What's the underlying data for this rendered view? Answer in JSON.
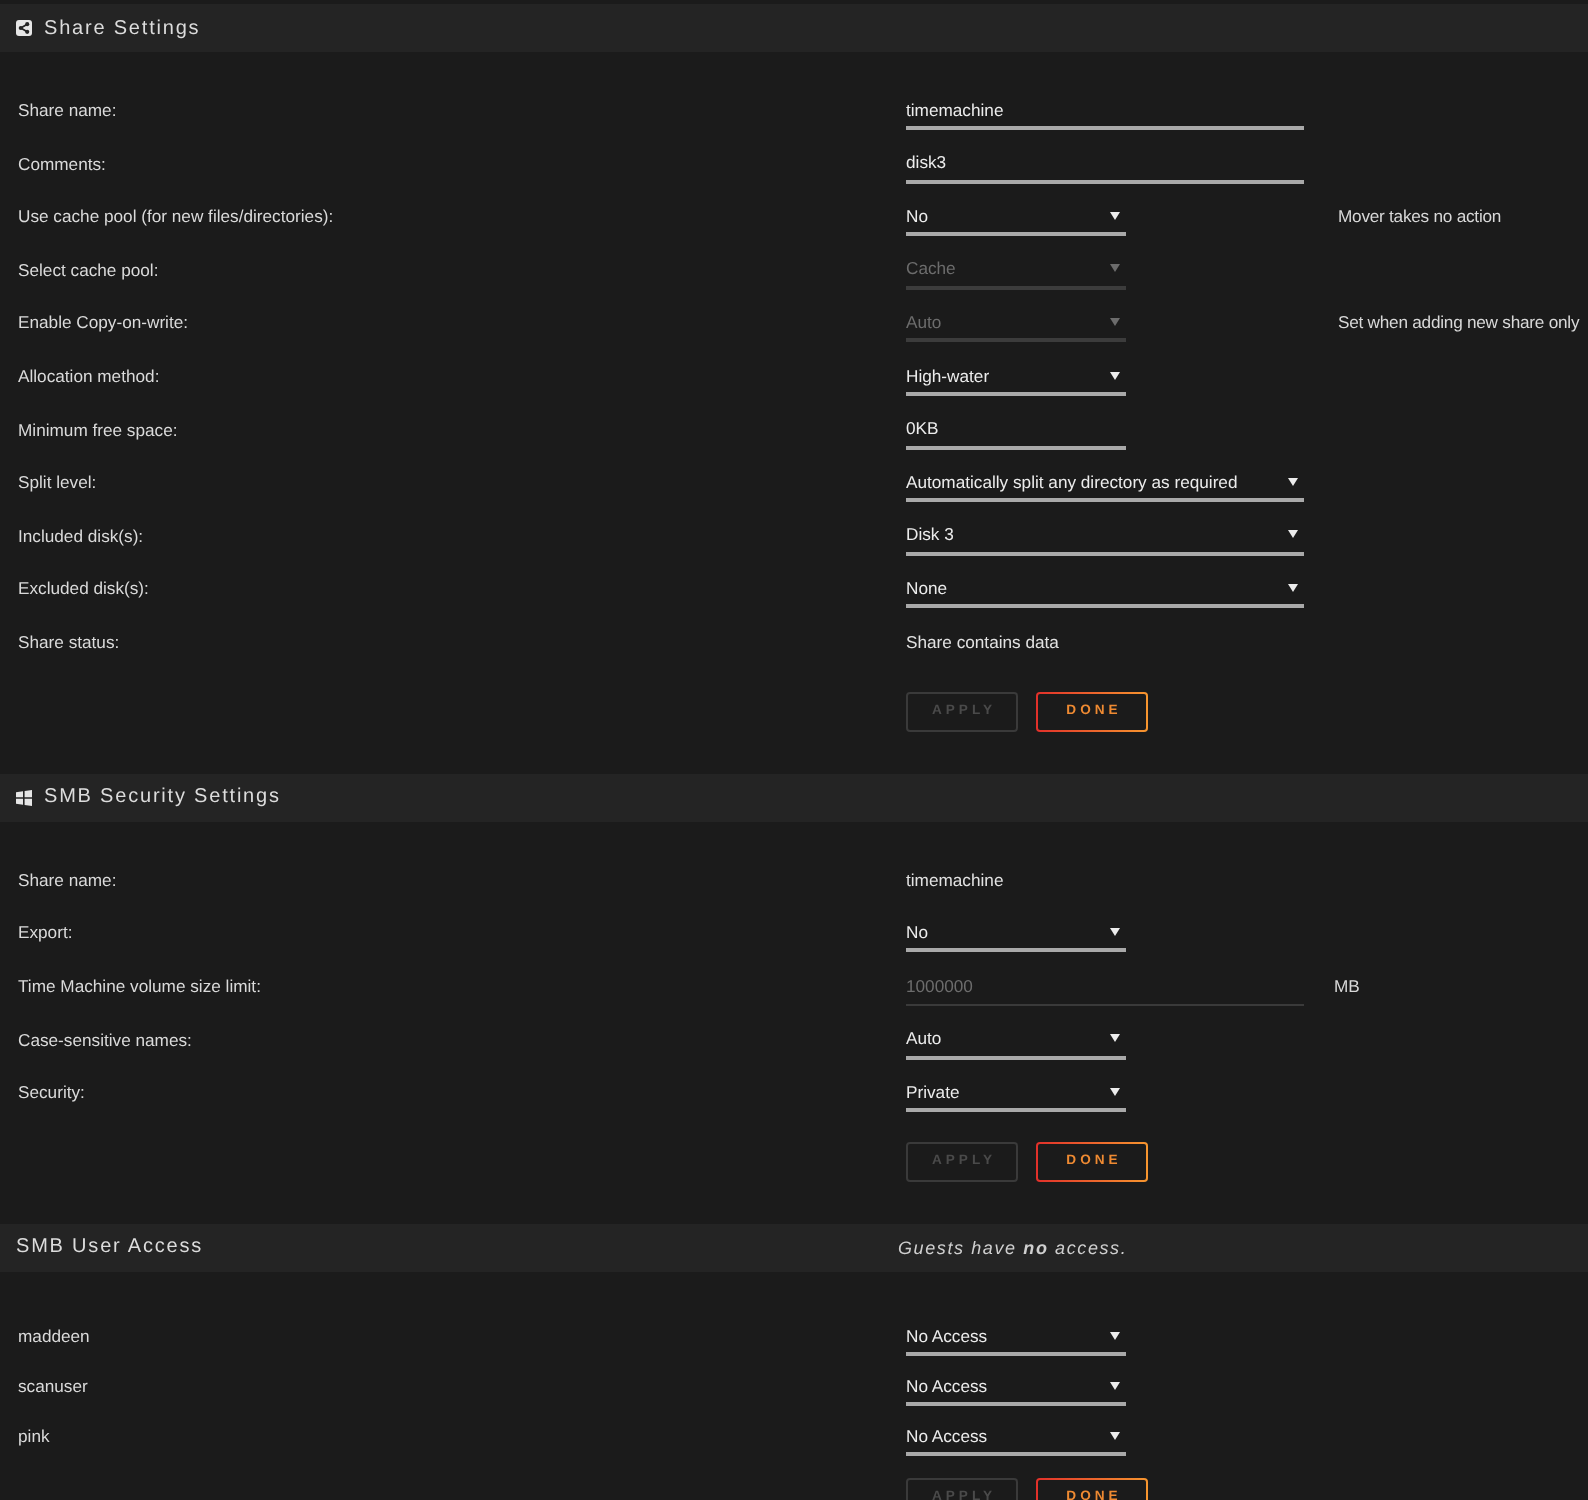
{
  "sections": [
    {
      "kind": "share",
      "title": "Share Settings",
      "rows": [
        {
          "label": "Share name:",
          "kind": "input",
          "value": "timemachine",
          "wide": true,
          "disabled": false
        },
        {
          "label": "Comments:",
          "kind": "input",
          "value": "disk3",
          "wide": true,
          "disabled": false
        },
        {
          "label": "Use cache pool (for new files/directories):",
          "kind": "select",
          "value": "No",
          "wide": false,
          "disabled": false,
          "note": "Mover takes no action"
        },
        {
          "label": "Select cache pool:",
          "kind": "select",
          "value": "Cache",
          "wide": false,
          "disabled": true
        },
        {
          "label": "Enable Copy-on-write:",
          "kind": "select",
          "value": "Auto",
          "wide": false,
          "disabled": true,
          "note": "Set when adding new share only"
        },
        {
          "label": "Allocation method:",
          "kind": "select",
          "value": "High-water",
          "wide": false,
          "disabled": false
        },
        {
          "label": "Minimum free space:",
          "kind": "input",
          "value": "0KB",
          "wide": false,
          "disabled": false
        },
        {
          "label": "Split level:",
          "kind": "select",
          "value": "Automatically split any directory as required",
          "wide": true,
          "disabled": false
        },
        {
          "label": "Included disk(s):",
          "kind": "select",
          "value": "Disk 3",
          "wide": true,
          "disabled": false
        },
        {
          "label": "Excluded disk(s):",
          "kind": "select",
          "value": "None",
          "wide": true,
          "disabled": false
        },
        {
          "label": "Share status:",
          "kind": "text",
          "value": "Share contains data"
        }
      ],
      "buttons": [
        {
          "label": "APPLY",
          "disabled": true
        },
        {
          "label": "DONE",
          "disabled": false
        }
      ]
    },
    {
      "kind": "smb",
      "title": "SMB Security Settings",
      "rows": [
        {
          "label": "Share name:",
          "kind": "text",
          "value": "timemachine"
        },
        {
          "label": "Export:",
          "kind": "select",
          "value": "No",
          "wide": false,
          "disabled": false
        },
        {
          "label": "Time Machine volume size limit:",
          "kind": "input",
          "value": "1000000",
          "wide": true,
          "disabled": true,
          "unit": "MB"
        },
        {
          "label": "Case-sensitive names:",
          "kind": "select",
          "value": "Auto",
          "wide": false,
          "disabled": false
        },
        {
          "label": "Security:",
          "kind": "select",
          "value": "Private",
          "wide": false,
          "disabled": false
        }
      ],
      "buttons": [
        {
          "label": "APPLY",
          "disabled": true
        },
        {
          "label": "DONE",
          "disabled": false
        }
      ]
    },
    {
      "kind": "users",
      "title": "SMB User Access",
      "note": "Guests have **no** access.",
      "rows": [
        {
          "label": "maddeen",
          "kind": "select",
          "value": "No Access",
          "wide": false,
          "disabled": false
        },
        {
          "label": "scanuser",
          "kind": "select",
          "value": "No Access",
          "wide": false,
          "disabled": false
        },
        {
          "label": "pink",
          "kind": "select",
          "value": "No Access",
          "wide": false,
          "disabled": false
        }
      ],
      "buttons": [
        {
          "label": "APPLY",
          "disabled": true
        },
        {
          "label": "DONE",
          "disabled": false
        }
      ]
    }
  ]
}
